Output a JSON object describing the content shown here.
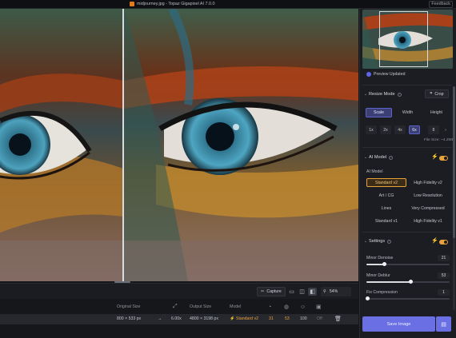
{
  "titlebar": {
    "title": "midjourney.jpg - Topaz Gigapixel AI 7.0.0",
    "feedback": "Feedback"
  },
  "toolbar": {
    "capture": "Capture",
    "zoom": "54%"
  },
  "queue": {
    "headers": {
      "original_size": "Original Size",
      "output_size": "Output Size",
      "model": "Model"
    },
    "row": {
      "original_size": "800 × 533 px",
      "arrow": "→",
      "scale": "6.00x",
      "output_size": "4800 × 3198 px",
      "model": "Standard v2",
      "val1": "31",
      "val2": "53",
      "val3": "100",
      "val4": "Off"
    }
  },
  "sidebar": {
    "preview_updated": "Preview Updated",
    "resize": {
      "title": "Resize Mode",
      "crop": "Crop",
      "tabs": [
        "Scale",
        "Width",
        "Height"
      ],
      "active_tab": "Scale",
      "scales": [
        "1x",
        "2x",
        "4x",
        "6x",
        "8"
      ],
      "active_scale": "6x",
      "file_size": "File Size: ~4.2MB"
    },
    "ai_model": {
      "title": "AI Model",
      "label": "AI Model",
      "models": [
        "Standard v2",
        "High Fidelity v2",
        "Art / CG",
        "Low Resolution",
        "Lines",
        "Very Compressed",
        "Standard v1",
        "High Fidelity v1"
      ],
      "active_model": "Standard v2"
    },
    "settings": {
      "title": "Settings",
      "denoise_label": "Minor Denoise",
      "denoise_value": "21",
      "denoise_level": 0.21,
      "deblur_label": "Minor Deblur",
      "deblur_value": "53",
      "deblur_level": 0.53,
      "compression_label": "Fix Compression",
      "compression_value": "1",
      "compression_level": 0.01
    },
    "save": "Save Image"
  },
  "colors": {
    "accent": "#6a6fe4",
    "orange": "#e8a23a",
    "background": "#16171b"
  }
}
